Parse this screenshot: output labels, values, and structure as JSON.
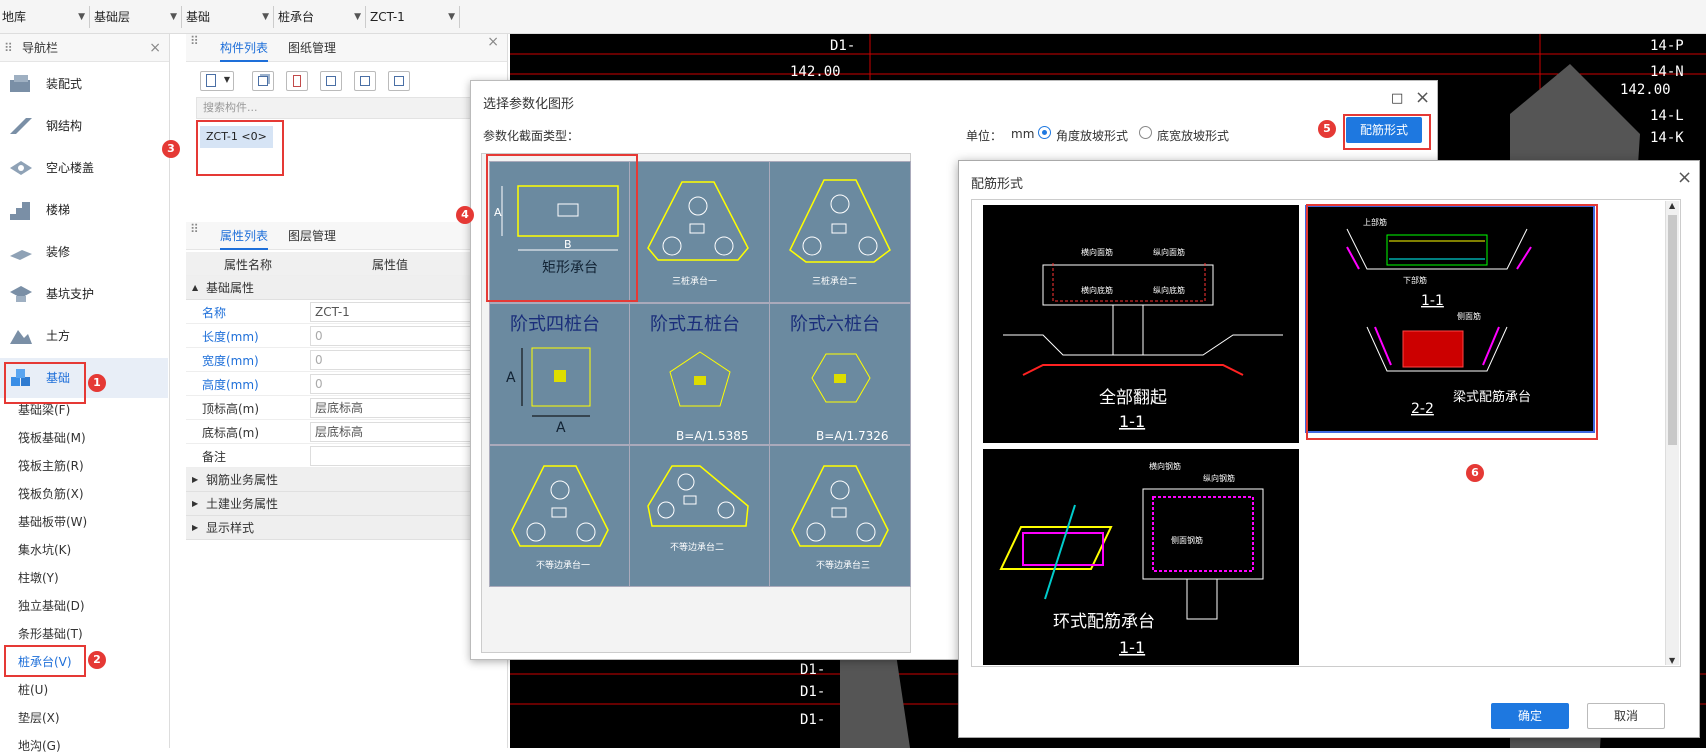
{
  "topbar": {
    "floor": "地库",
    "layer": "基础层",
    "category": "基础",
    "type": "桩承台",
    "item": "ZCT-1"
  },
  "nav": {
    "title": "导航栏",
    "items": [
      {
        "label": "装配式",
        "icon": "prefab-icon"
      },
      {
        "label": "钢结构",
        "icon": "steel-icon"
      },
      {
        "label": "空心楼盖",
        "icon": "hollow-slab-icon"
      },
      {
        "label": "楼梯",
        "icon": "stair-icon"
      },
      {
        "label": "装修",
        "icon": "decoration-icon"
      },
      {
        "label": "基坑支护",
        "icon": "pit-support-icon"
      },
      {
        "label": "土方",
        "icon": "earthwork-icon"
      },
      {
        "label": "基础",
        "icon": "foundation-icon"
      }
    ],
    "subitems": [
      "基础梁(F)",
      "筏板基础(M)",
      "筏板主筋(R)",
      "筏板负筋(X)",
      "基础板带(W)",
      "集水坑(K)",
      "柱墩(Y)",
      "独立基础(D)",
      "条形基础(T)",
      "桩承台(V)",
      "桩(U)",
      "垫层(X)",
      "地沟(G)"
    ]
  },
  "badges": [
    "1",
    "2",
    "3",
    "4",
    "5",
    "6"
  ],
  "components": {
    "tab_list": "构件列表",
    "tab_drawing": "图纸管理",
    "search_placeholder": "搜索构件...",
    "item": "ZCT-1 <0>"
  },
  "properties": {
    "tab_props": "属性列表",
    "tab_layers": "图层管理",
    "col_name": "属性名称",
    "col_value": "属性值",
    "group_basic": "基础属性",
    "rows": [
      {
        "name": "名称",
        "value": "ZCT-1"
      },
      {
        "name": "长度(mm)",
        "value": "0"
      },
      {
        "name": "宽度(mm)",
        "value": "0"
      },
      {
        "name": "高度(mm)",
        "value": "0"
      },
      {
        "name": "顶标高(m)",
        "value": "层底标高"
      },
      {
        "name": "底标高(m)",
        "value": "层底标高"
      },
      {
        "name": "备注",
        "value": ""
      }
    ],
    "groups": [
      "钢筋业务属性",
      "土建业务属性",
      "显示样式"
    ]
  },
  "cad": {
    "labels": [
      "D1-",
      "142.00",
      "14-P",
      "14-N",
      "142.00",
      "14-L",
      "14-K",
      "D1-",
      "D1-",
      "D1-"
    ]
  },
  "dialog1": {
    "title": "选择参数化图形",
    "section_label": "参数化截面类型：",
    "unit_label": "单位：",
    "unit": "mm",
    "radio1": "角度放坡形式",
    "radio2": "底宽放坡形式",
    "rebar_button": "配筋形式",
    "thumbs": [
      {
        "label": "矩形承台",
        "dim_a": "A",
        "dim_b": "B"
      },
      {
        "label": "三桩承台一"
      },
      {
        "label": "三桩承台二"
      },
      {
        "label": "阶式四桩台",
        "dim_a": "A",
        "dim_b": "A"
      },
      {
        "label": "阶式五桩台",
        "formula": "B=A/1.5385"
      },
      {
        "label": "阶式六桩台",
        "formula": "B=A/1.7326"
      },
      {
        "label": "不等边承台一"
      },
      {
        "label": "不等边承台二"
      },
      {
        "label": "不等边承台三"
      }
    ]
  },
  "dialog2": {
    "title": "配筋形式",
    "ok": "确定",
    "cancel": "取消",
    "t1": {
      "caption": "全部翻起",
      "section": "1-1",
      "labels": [
        "横向面筋",
        "纵向面筋",
        "横向底筋",
        "纵向底筋"
      ]
    },
    "t2": {
      "caption": "梁式配筋承台",
      "section1": "1-1",
      "section2": "2-2",
      "labels": [
        "上部筋",
        "下部筋",
        "侧面筋"
      ]
    },
    "t3": {
      "caption": "环式配筋承台",
      "section": "1-1",
      "labels": [
        "横向钢筋",
        "纵向钢筋",
        "侧面钢筋"
      ]
    }
  },
  "colors": {
    "accent": "#1e78e0",
    "badge": "#e53935",
    "thumb_bg": "#6b8aa0"
  }
}
